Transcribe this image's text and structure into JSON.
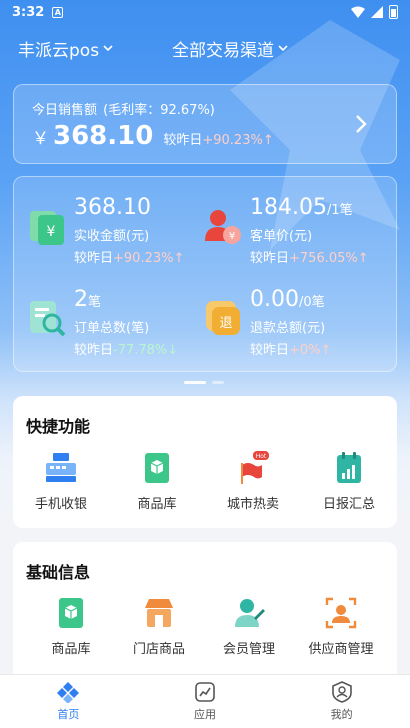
{
  "statusbar": {
    "time": "3:32",
    "app_badge": "A"
  },
  "header": {
    "store": "丰派云pos",
    "channel": "全部交易渠道"
  },
  "today": {
    "label": "今日销售额",
    "margin": "(毛利率：92.67%)",
    "currency": "￥",
    "amount": "368.10",
    "compare_label": "较昨日",
    "compare_value": "+90.23%",
    "compare_arrow": "↑"
  },
  "metrics": [
    {
      "value": "368.10",
      "unit": "",
      "label": "实收金额(元)",
      "compare_label": "较昨日",
      "compare_value": "+90.23%",
      "arrow": "↑",
      "trend": "up",
      "icon": "money-icon"
    },
    {
      "value": "184.05",
      "unit": "/1笔",
      "label": "客单价(元)",
      "compare_label": "较昨日",
      "compare_value": "+756.05%",
      "arrow": "↑",
      "trend": "up",
      "icon": "customer-icon"
    },
    {
      "value": "2",
      "unit": "笔",
      "label": "订单总数(笔)",
      "compare_label": "较昨日",
      "compare_value": "-77.78%",
      "arrow": "↓",
      "trend": "down",
      "icon": "order-search-icon"
    },
    {
      "value": "0.00",
      "unit": "/0笔",
      "label": "退款总额(元)",
      "compare_label": "较昨日",
      "compare_value": "+0%",
      "arrow": "↑",
      "trend": "up",
      "icon": "refund-icon"
    }
  ],
  "refund_icon_text": "退",
  "shortcuts": {
    "title": "快捷功能",
    "items": [
      {
        "label": "手机收银",
        "icon": "cash-register-icon"
      },
      {
        "label": "商品库",
        "icon": "product-library-icon"
      },
      {
        "label": "城市热卖",
        "icon": "hot-flag-icon",
        "badge": "Hot"
      },
      {
        "label": "日报汇总",
        "icon": "daily-report-icon"
      }
    ]
  },
  "basic": {
    "title": "基础信息",
    "items": [
      {
        "label": "商品库",
        "icon": "product-library-icon"
      },
      {
        "label": "门店商品",
        "icon": "store-icon"
      },
      {
        "label": "会员管理",
        "icon": "member-icon"
      },
      {
        "label": "供应商管理",
        "icon": "supplier-icon"
      }
    ]
  },
  "nav": [
    {
      "label": "首页",
      "icon": "home-icon",
      "active": true
    },
    {
      "label": "应用",
      "icon": "apps-icon",
      "active": false
    },
    {
      "label": "我的",
      "icon": "profile-icon",
      "active": false
    }
  ],
  "colors": {
    "primary": "#2f7ff0",
    "up": "#ffd0c8",
    "down": "#b9f5cf",
    "green_icon": "#3cc68a",
    "orange_icon": "#f08a3c",
    "red_icon": "#e8453c"
  }
}
